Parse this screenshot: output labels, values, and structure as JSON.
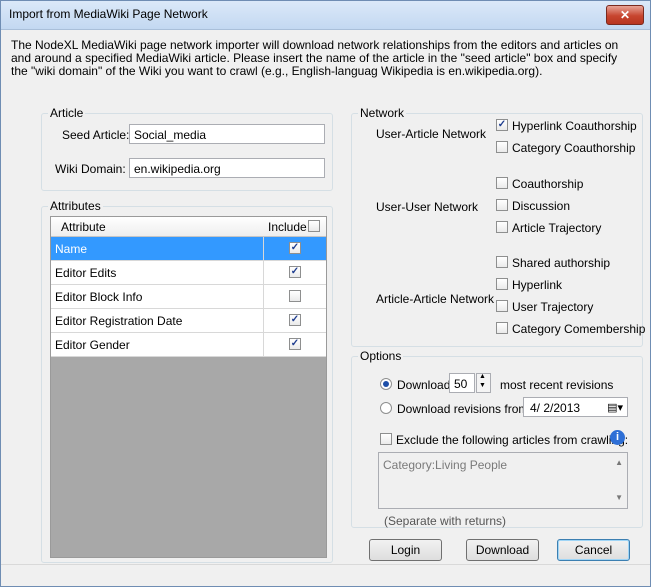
{
  "window": {
    "title": "Import from MediaWiki Page Network",
    "close_label": "✕"
  },
  "intro": "The NodeXL MediaWiki page network importer will download network relationships from the editors and articles on and around a specified MediaWiki article. Please insert the name of the article in the \"seed article\" box and specify the \"wiki domain\" of the Wiki you want to crawl (e.g., English-languag Wikipedia is en.wikipedia.org).",
  "article": {
    "group_label": "Article",
    "seed_label": "Seed Article:",
    "seed_value": "Social_media",
    "domain_label": "Wiki Domain:",
    "domain_value": "en.wikipedia.org"
  },
  "attributes": {
    "group_label": "Attributes",
    "col_attribute": "Attribute",
    "col_include": "Include",
    "include_all_checked": false,
    "rows": [
      {
        "name": "Name",
        "include": true,
        "selected": true
      },
      {
        "name": "Editor Edits",
        "include": true,
        "selected": false
      },
      {
        "name": "Editor Block Info",
        "include": false,
        "selected": false
      },
      {
        "name": "Editor Registration Date",
        "include": true,
        "selected": false
      },
      {
        "name": "Editor Gender",
        "include": true,
        "selected": false
      }
    ]
  },
  "network": {
    "group_label": "Network",
    "user_article": {
      "label": "User-Article Network",
      "options": [
        {
          "label": "Hyperlink Coauthorship",
          "checked": true
        },
        {
          "label": "Category Coauthorship",
          "checked": false
        }
      ]
    },
    "user_user": {
      "label": "User-User Network",
      "options": [
        {
          "label": "Coauthorship",
          "checked": false
        },
        {
          "label": "Discussion",
          "checked": false
        },
        {
          "label": "Article Trajectory",
          "checked": false
        }
      ]
    },
    "article_article": {
      "label": "Article-Article Network",
      "options": [
        {
          "label": "Shared authorship",
          "checked": false
        },
        {
          "label": "Hyperlink",
          "checked": false
        },
        {
          "label": "User Trajectory",
          "checked": false
        },
        {
          "label": "Category Comembership",
          "checked": false
        }
      ]
    }
  },
  "options": {
    "group_label": "Options",
    "download_label": "Download",
    "download_count": "50",
    "recent_label": "most recent revisions",
    "from_label": "Download revisions from:",
    "from_date": "4/ 2/2013",
    "exclude_label": "Exclude the following articles from crawling:",
    "exclude_text": "Category:Living People",
    "separate_hint": "(Separate with returns)"
  },
  "buttons": {
    "login": "Login",
    "download": "Download",
    "cancel": "Cancel"
  }
}
